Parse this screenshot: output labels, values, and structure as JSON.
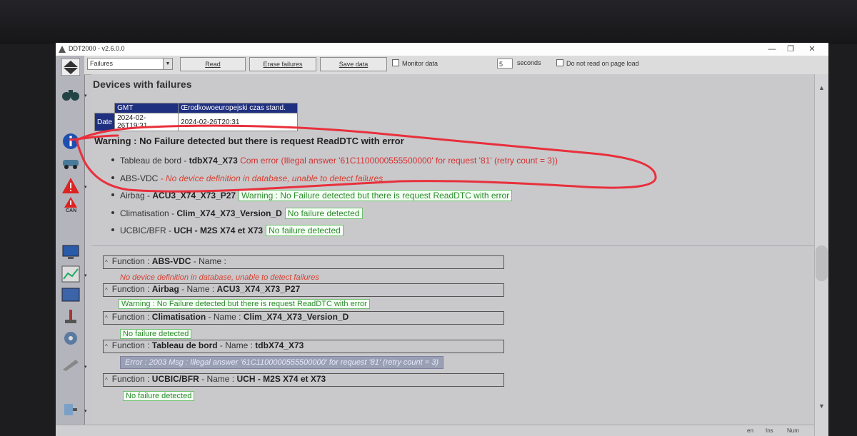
{
  "window": {
    "title": "DDT2000 - v2.6.0.0"
  },
  "toolbar": {
    "mode_select": "Failures",
    "read_label": "Read",
    "erase_label": "Erase failures",
    "save_label": "Save data",
    "monitor_label": "Monitor data",
    "interval_value": "5",
    "seconds_label": "seconds",
    "noread_label": "Do not read on page load"
  },
  "sidebar": {
    "can_label": "CAN"
  },
  "main": {
    "heading": "Devices with failures",
    "gmt_table": {
      "gmt_label": "GMT",
      "tz_label": "Œrodkowoeuropejski czas stand.",
      "date_label": "Date",
      "date_gmt": "2024-02-26T19:31",
      "date_local": "2024-02-26T20:31"
    },
    "warning_title": "Warning : No Failure detected but there is request ReadDTC with error",
    "devices": [
      {
        "label": "Tableau de bord - ",
        "name": "tdbX74_X73",
        "status": " Com error (Illegal answer '61C1100000555500000' for request '81' (retry count = 3))",
        "kind": "err"
      },
      {
        "label": "ABS-VDC",
        "name": "",
        "status": " - No device definition in database, unable to detect failures",
        "kind": "err-it"
      },
      {
        "label": "Airbag - ",
        "name": "ACU3_X74_X73_P27",
        "status": "Warning : No Failure detected but there is request ReadDTC with error",
        "kind": "warn"
      },
      {
        "label": "Climatisation - ",
        "name": "Clim_X74_X73_Version_D",
        "status": "No failure detected",
        "kind": "ok"
      },
      {
        "label": "UCBIC/BFR - ",
        "name": "UCH - M2S X74 et X73",
        "status": "No failure detected",
        "kind": "ok"
      }
    ],
    "functions": [
      {
        "prefix": "Function : ",
        "func": "ABS-VDC",
        "mid": " - Name : ",
        "name": "",
        "detail": "No device definition in database, unable to detect failures",
        "detail_kind": "err-it"
      },
      {
        "prefix": "Function : ",
        "func": "Airbag",
        "mid": " - Name : ",
        "name": "ACU3_X74_X73_P27",
        "detail": "Warning : No Failure detected but there is request ReadDTC with error",
        "detail_kind": "ok"
      },
      {
        "prefix": "Function : ",
        "func": "Climatisation",
        "mid": " - Name : ",
        "name": "Clim_X74_X73_Version_D",
        "detail": "No failure detected",
        "detail_kind": "ok"
      },
      {
        "prefix": "Function : ",
        "func": "Tableau de bord",
        "mid": " - Name : ",
        "name": "tdbX74_X73",
        "detail": "Error : 2003 Msg : Illegal answer '61C1100000555500000' for request '81' (retry count = 3)",
        "detail_kind": "errbox"
      },
      {
        "prefix": "Function : ",
        "func": "UCBIC/BFR",
        "mid": " - Name : ",
        "name": "UCH - M2S X74 et X73",
        "detail": "No failure detected",
        "detail_kind": "ok"
      }
    ]
  },
  "statusbar": {
    "ind1": "en",
    "ind2": "Ins",
    "ind3": "Num"
  },
  "colors": {
    "accent": "#203080",
    "error": "#d43030",
    "ok": "#2e8a2e",
    "annotation": "#e8303c"
  }
}
